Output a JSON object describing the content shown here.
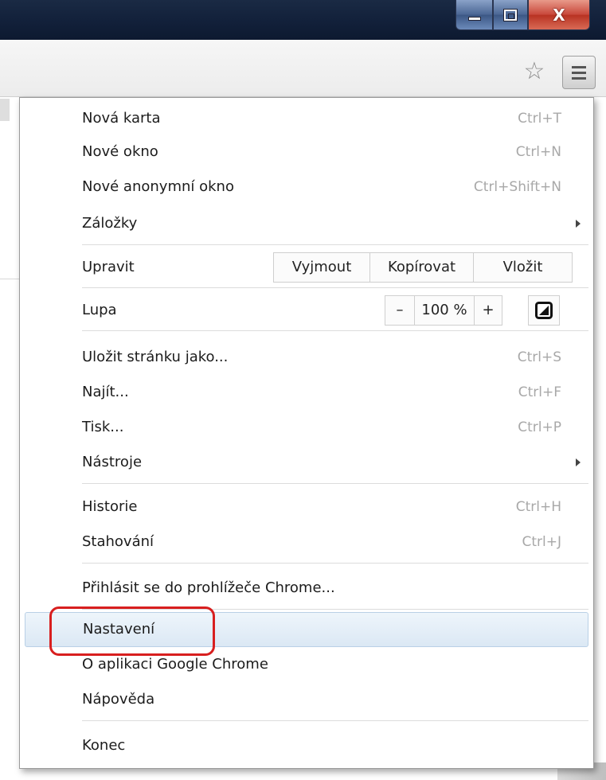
{
  "toolbar": {
    "star_icon": "☆",
    "menu_icon": "hamburger-icon"
  },
  "window_controls": {
    "close_glyph": "X"
  },
  "menu": {
    "items": [
      {
        "label": "Nová karta",
        "shortcut": "Ctrl+T"
      },
      {
        "label": "Nové okno",
        "shortcut": "Ctrl+N"
      },
      {
        "label": "Nové anonymní okno",
        "shortcut": "Ctrl+Shift+N"
      },
      {
        "label": "Záložky",
        "shortcut": ""
      }
    ],
    "edit": {
      "label": "Upravit",
      "cut": "Vyjmout",
      "copy": "Kopírovat",
      "paste": "Vložit"
    },
    "zoom": {
      "label": "Lupa",
      "minus": "–",
      "value": "100 %",
      "plus": "+"
    },
    "page_items": [
      {
        "label": "Uložit stránku jako...",
        "shortcut": "Ctrl+S"
      },
      {
        "label": "Najít...",
        "shortcut": "Ctrl+F"
      },
      {
        "label": "Tisk...",
        "shortcut": "Ctrl+P"
      },
      {
        "label": "Nástroje",
        "shortcut": ""
      }
    ],
    "history_items": [
      {
        "label": "Historie",
        "shortcut": "Ctrl+H"
      },
      {
        "label": "Stahování",
        "shortcut": "Ctrl+J"
      }
    ],
    "signin": "Přihlásit se do prohlížeče Chrome...",
    "settings": "Nastavení",
    "about": "O aplikaci Google Chrome",
    "help": "Nápověda",
    "exit": "Konec"
  },
  "colors": {
    "highlight": "#dbe8f4",
    "annotation": "#d81f1f",
    "shortcut_text": "#a8a8a8"
  }
}
